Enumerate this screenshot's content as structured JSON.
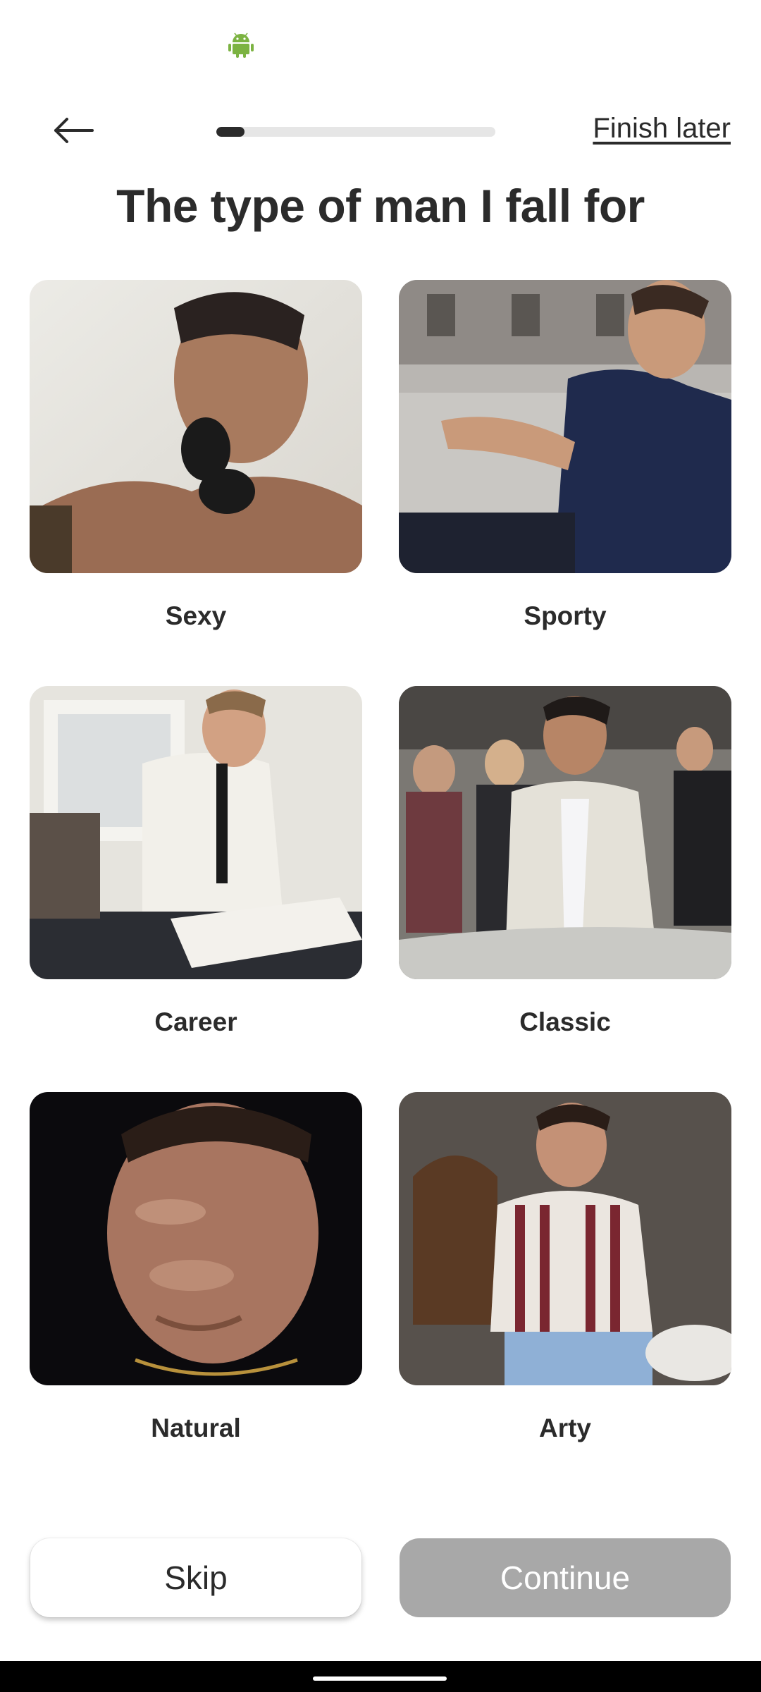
{
  "header": {
    "finish_later_label": "Finish later",
    "progress": 0.1
  },
  "page": {
    "title": "The type of man I fall for"
  },
  "options": [
    {
      "label": "Sexy"
    },
    {
      "label": "Sporty"
    },
    {
      "label": "Career"
    },
    {
      "label": "Classic"
    },
    {
      "label": "Natural"
    },
    {
      "label": "Arty"
    }
  ],
  "actions": {
    "skip_label": "Skip",
    "continue_label": "Continue"
  },
  "colors": {
    "text": "#2b2b2b",
    "progress_track": "#e6e6e6",
    "continue_disabled": "#a8a8a8",
    "android": "#7cb342"
  }
}
